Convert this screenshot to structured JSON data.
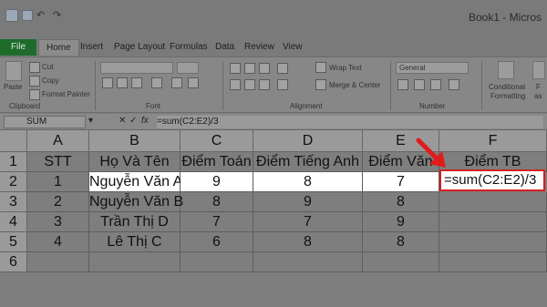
{
  "app": {
    "title": "Book1 - Micros"
  },
  "tabs": [
    "File",
    "Home",
    "Insert",
    "Page Layout",
    "Formulas",
    "Data",
    "Review",
    "View"
  ],
  "ribbon": {
    "clipboard": {
      "paste": "Paste",
      "cut": "Cut",
      "copy": "Copy",
      "format_painter": "Format Painter",
      "group": "Clipboard"
    },
    "font": {
      "group": "Font"
    },
    "alignment": {
      "wrap": "Wrap Text",
      "merge": "Merge & Center",
      "group": "Alignment"
    },
    "number": {
      "format": "General",
      "group": "Number"
    },
    "styles": {
      "conditional": "Conditional",
      "formatting": "Formatting",
      "format_as": "F",
      "as_table": "as"
    }
  },
  "formula_bar": {
    "name_box": "SUM",
    "fx": "fx",
    "formula": "=sum(C2:E2)/3"
  },
  "columns": [
    "A",
    "B",
    "C",
    "D",
    "E",
    "F"
  ],
  "rows": [
    "1",
    "2",
    "3",
    "4",
    "5",
    "6"
  ],
  "table": {
    "headers": [
      "STT",
      "Họ Và Tên",
      "Điểm Toán",
      "Điểm Tiếng Anh",
      "Điểm Văn",
      "Điểm TB"
    ],
    "data": [
      [
        "1",
        "Nguyễn Văn A",
        "9",
        "8",
        "7",
        "=sum(C2:E2)/3"
      ],
      [
        "2",
        "Nguyễn Văn B",
        "8",
        "9",
        "8",
        ""
      ],
      [
        "3",
        "Trần Thị D",
        "7",
        "7",
        "9",
        ""
      ],
      [
        "4",
        "Lê Thị C",
        "6",
        "8",
        "8",
        ""
      ]
    ]
  },
  "colors": {
    "highlight_border": "#d62020",
    "arrow": "#e01c1c",
    "file_tab": "#1f6b2c"
  }
}
